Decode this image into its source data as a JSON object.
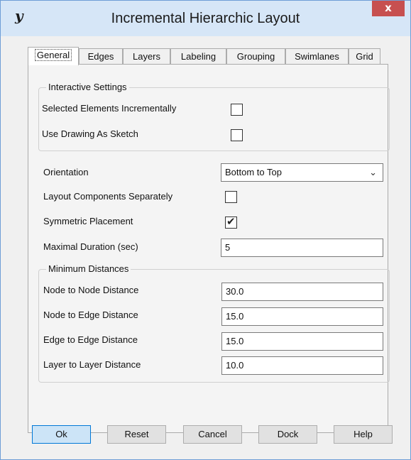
{
  "window": {
    "title": "Incremental Hierarchic Layout",
    "logo": "y",
    "close_label": "x"
  },
  "tabs": [
    {
      "label": "General",
      "active": true
    },
    {
      "label": "Edges"
    },
    {
      "label": "Layers"
    },
    {
      "label": "Labeling"
    },
    {
      "label": "Grouping"
    },
    {
      "label": "Swimlanes"
    },
    {
      "label": "Grid"
    }
  ],
  "interactive_settings": {
    "title": "Interactive Settings",
    "selected_incrementally": {
      "label": "Selected Elements Incrementally",
      "checked": false
    },
    "use_drawing_as_sketch": {
      "label": "Use Drawing As Sketch",
      "checked": false
    }
  },
  "general": {
    "orientation": {
      "label": "Orientation",
      "value": "Bottom to Top"
    },
    "layout_components_separately": {
      "label": "Layout Components Separately",
      "checked": false
    },
    "symmetric_placement": {
      "label": "Symmetric Placement",
      "checked": true,
      "mark": "✔"
    },
    "maximal_duration": {
      "label": "Maximal Duration (sec)",
      "value": "5"
    }
  },
  "minimum_distances": {
    "title": "Minimum Distances",
    "node_to_node": {
      "label": "Node to Node Distance",
      "value": "30.0"
    },
    "node_to_edge": {
      "label": "Node to Edge Distance",
      "value": "15.0"
    },
    "edge_to_edge": {
      "label": "Edge to Edge Distance",
      "value": "15.0"
    },
    "layer_to_layer": {
      "label": "Layer to Layer Distance",
      "value": "10.0"
    }
  },
  "buttons": {
    "ok": "Ok",
    "reset": "Reset",
    "cancel": "Cancel",
    "dock": "Dock",
    "help": "Help"
  },
  "colors": {
    "titlebar": "#d6e6f7",
    "close": "#c75050",
    "default_button": "#cce4f7"
  }
}
